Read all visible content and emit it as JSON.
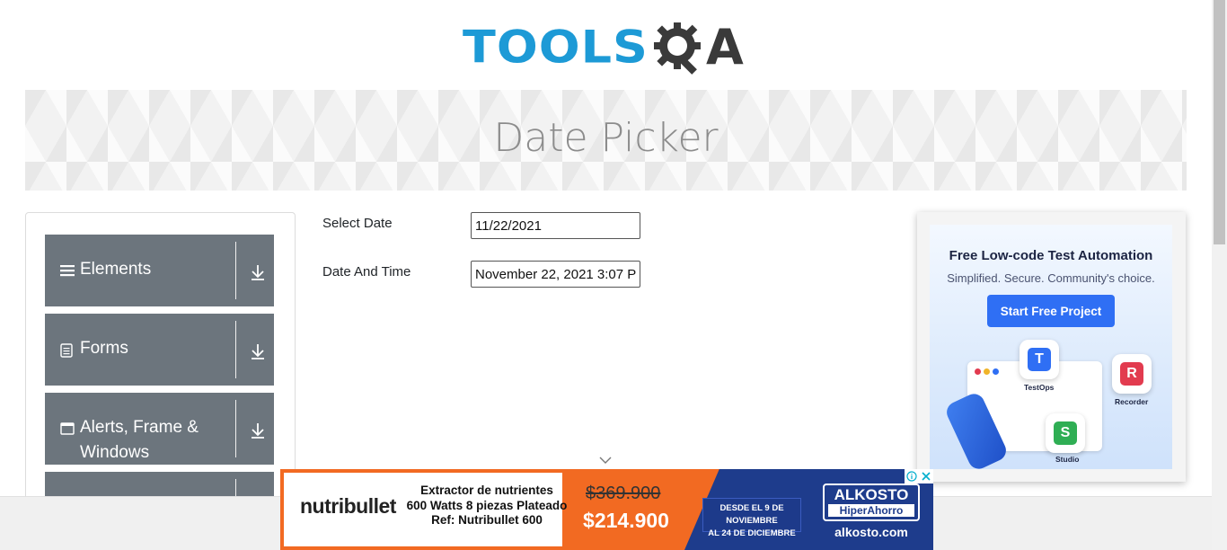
{
  "header": {
    "logo_text_left": "TOOLS",
    "logo_text_right": "A",
    "logo_icon": "gear-magnifier-icon"
  },
  "banner": {
    "title": "Date Picker"
  },
  "sidebar": {
    "groups": [
      {
        "label": "Elements",
        "icon": "hamburger-icon"
      },
      {
        "label": "Forms",
        "icon": "document-icon"
      },
      {
        "label": "Alerts, Frame &",
        "label2": "Windows",
        "icon": "window-icon"
      },
      {
        "label": "",
        "icon": ""
      }
    ]
  },
  "form": {
    "select_date_label": "Select Date",
    "select_date_value": "11/22/2021",
    "date_time_label": "Date And Time",
    "date_time_value": "November 22, 2021 3:07 P"
  },
  "right_ad": {
    "title": "Free Low-code Test Automation",
    "subtitle": "Simplified. Secure. Community's choice.",
    "button": "Start Free Project",
    "apps": [
      {
        "name": "TestOps",
        "letter": "T",
        "color": "#2f6ff4"
      },
      {
        "name": "Recorder",
        "letter": "R",
        "color": "#e23b4f"
      },
      {
        "name": "Studio",
        "letter": "S",
        "color": "#2fae54"
      }
    ]
  },
  "bottom_ad": {
    "brand": "nutribullet",
    "desc_line1": "Extractor de nutrientes",
    "desc_line2": "600 Watts 8 piezas Plateado",
    "desc_line3": "Ref: Nutribullet 600",
    "old_price": "$369.900",
    "new_price": "$214.900",
    "dates_line1": "DESDE EL 9 DE NOVIEMBRE",
    "dates_line2": "AL 24 DE DICIEMBRE",
    "store_name": "ALKOSTO",
    "store_tag": "HiperAhorro",
    "store_url": "alkosto.com"
  },
  "colors": {
    "brand_blue": "#1d9ad6",
    "sidebar_gray": "#6c757d",
    "ad_orange": "#f26a22",
    "ad_navy": "#1e3c8c"
  }
}
